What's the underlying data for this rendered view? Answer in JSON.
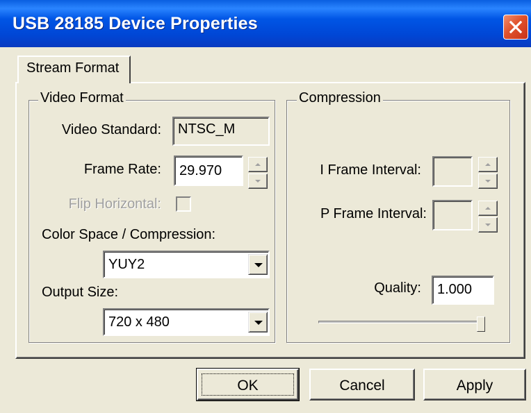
{
  "window": {
    "title": "USB 28185 Device Properties",
    "close_icon": "close-icon"
  },
  "tabs": [
    {
      "label": "Stream Format",
      "selected": true
    }
  ],
  "video_format": {
    "group_label": "Video Format",
    "video_standard_label": "Video Standard:",
    "video_standard_value": "NTSC_M",
    "frame_rate_label": "Frame Rate:",
    "frame_rate_value": "29.970",
    "flip_horizontal_label": "Flip Horizontal:",
    "flip_horizontal_checked": false,
    "color_space_label": "Color Space / Compression:",
    "color_space_value": "YUY2",
    "output_size_label": "Output Size:",
    "output_size_value": "720 x 480"
  },
  "compression": {
    "group_label": "Compression",
    "i_frame_label": "I Frame Interval:",
    "i_frame_value": "",
    "p_frame_label": "P Frame Interval:",
    "p_frame_value": "",
    "quality_label": "Quality:",
    "quality_value": "1.000",
    "quality_slider_level": 1.0
  },
  "buttons": {
    "ok": "OK",
    "cancel": "Cancel",
    "apply": "Apply"
  },
  "colors": {
    "titlebar": "#0055e5",
    "dialog_bg": "#ece9d8",
    "close_button": "#e0522c"
  }
}
